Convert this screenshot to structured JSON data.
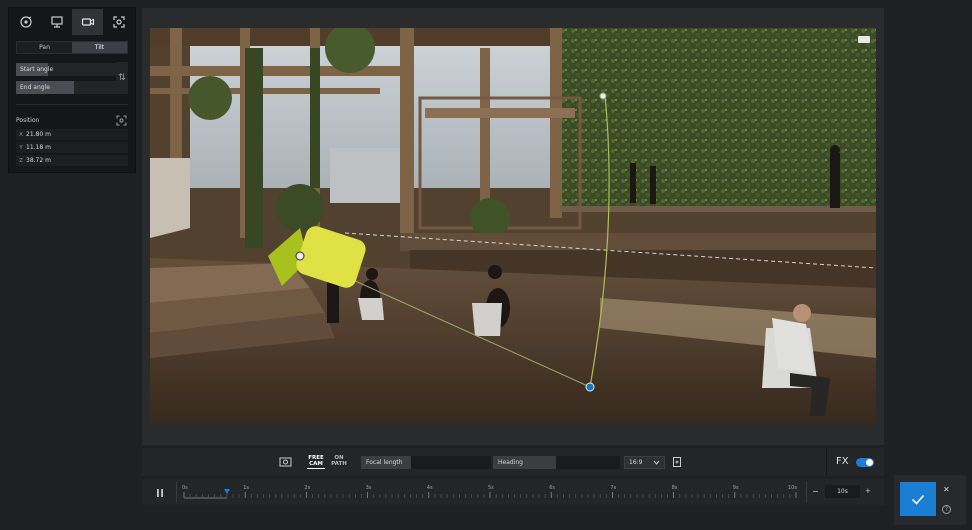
{
  "camera_panel": {
    "tabs": [
      {
        "icon": "orbit-icon",
        "active": false
      },
      {
        "icon": "screen-icon",
        "active": false
      },
      {
        "icon": "camera-icon",
        "active": true
      },
      {
        "icon": "focus-icon",
        "active": false
      }
    ],
    "pan_label": "Pan",
    "tilt_label": "Tilt",
    "active_mode": "Tilt",
    "start_angle_label": "Start angle",
    "start_angle_level": 0.32,
    "end_angle_label": "End angle",
    "end_angle_level": 0.58,
    "swap_glyph": "⇅",
    "position_title": "Position",
    "position": [
      {
        "axis": "X",
        "value": "21.80 m"
      },
      {
        "axis": "Y",
        "value": "11.18 m"
      },
      {
        "axis": "Z",
        "value": "38.72 m"
      }
    ]
  },
  "toolbar": {
    "free_cam_line1": "FREE",
    "free_cam_line2": "CAM",
    "on_path_line1": "ON",
    "on_path_line2": "PATH",
    "focal_length_label": "Focal length",
    "heading_label": "Heading",
    "aspect_ratio": "16:9",
    "fx_label": "FX",
    "fx_enabled": true,
    "accent_color": "#1a7fd4"
  },
  "timeline": {
    "ticks": [
      "0s",
      "1s",
      "2s",
      "3s",
      "4s",
      "5s",
      "6s",
      "7s",
      "8s",
      "9s",
      "10s"
    ],
    "playhead_seconds": 0.7,
    "duration_value": "10s",
    "minus_label": "−",
    "plus_label": "+"
  },
  "confirm": {
    "close_label": "✕",
    "help_label": "?"
  }
}
